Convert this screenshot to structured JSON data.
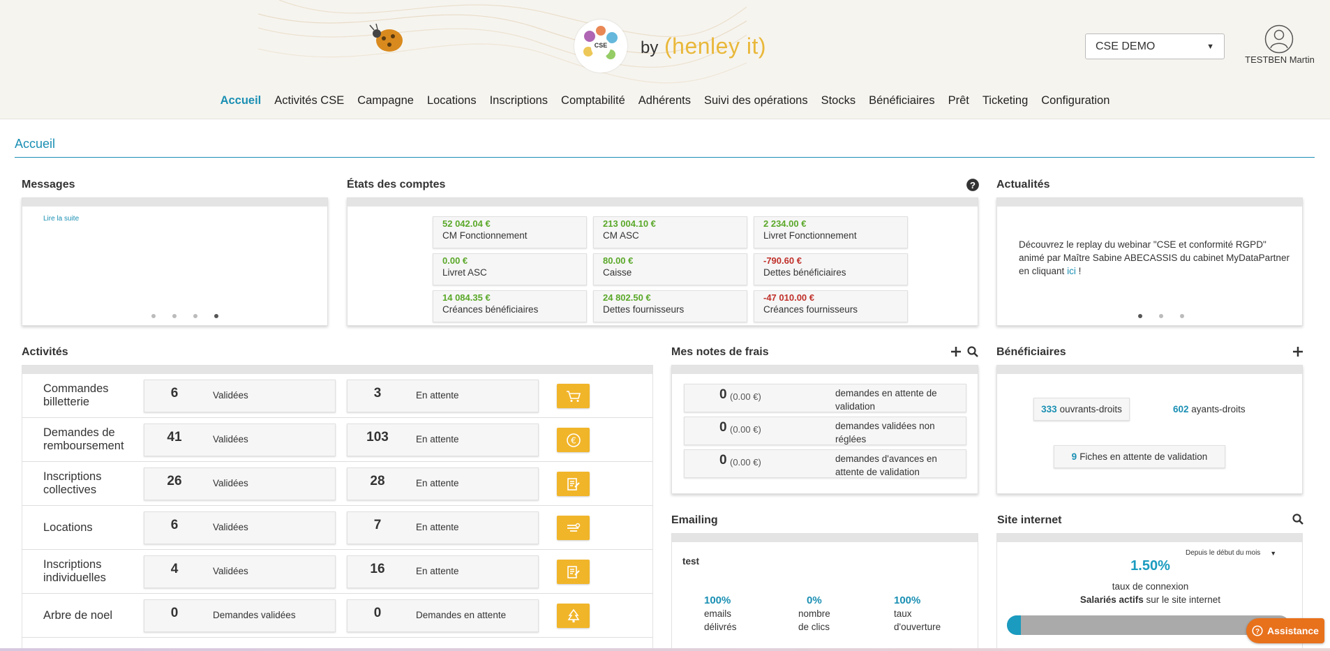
{
  "header": {
    "logo_text": "CSE",
    "by": "by",
    "brand": "(henley it)",
    "company_select": "CSE DEMO",
    "user_name": "TESTBEN Martin"
  },
  "nav": [
    "Accueil",
    "Activités CSE",
    "Campagne",
    "Locations",
    "Inscriptions",
    "Comptabilité",
    "Adhérents",
    "Suivi des opérations",
    "Stocks",
    "Bénéficiaires",
    "Prêt",
    "Ticketing",
    "Configuration"
  ],
  "page_title": "Accueil",
  "messages": {
    "title": "Messages",
    "read_more": "Lire la suite"
  },
  "accounts": {
    "title": "États des comptes",
    "items": [
      {
        "amount": "52 042.04 €",
        "label": "CM Fonctionnement",
        "tone": "pos"
      },
      {
        "amount": "213 004.10 €",
        "label": "CM ASC",
        "tone": "pos"
      },
      {
        "amount": "2 234.00 €",
        "label": "Livret Fonctionnement",
        "tone": "pos"
      },
      {
        "amount": "0.00 €",
        "label": "Livret ASC",
        "tone": "pos"
      },
      {
        "amount": "80.00 €",
        "label": "Caisse",
        "tone": "pos"
      },
      {
        "amount": "-790.60 €",
        "label": "Dettes bénéficiaires",
        "tone": "neg"
      },
      {
        "amount": "14 084.35 €",
        "label": "Créances bénéficiaires",
        "tone": "pos"
      },
      {
        "amount": "24 802.50 €",
        "label": "Dettes fournisseurs",
        "tone": "pos"
      },
      {
        "amount": "-47 010.00 €",
        "label": "Créances fournisseurs",
        "tone": "neg"
      }
    ]
  },
  "news": {
    "title": "Actualités",
    "text_1": "Découvrez le replay du webinar \"CSE et conformité RGPD\"",
    "text_2": "animé par Maître Sabine ABECASSIS du cabinet MyDataPartner",
    "text_3": "en cliquant",
    "link": "ici",
    "text_4": " !"
  },
  "activities": {
    "title": "Activités",
    "rows": [
      {
        "label_1": "Commandes",
        "label_2": "billetterie",
        "validated": "6",
        "validated_label": "Validées",
        "pending": "3",
        "pending_label": "En attente",
        "icon": "cart-icon"
      },
      {
        "label_1": "Demandes de",
        "label_2": "remboursement",
        "validated": "41",
        "validated_label": "Validées",
        "pending": "103",
        "pending_label": "En attente",
        "icon": "euro-icon"
      },
      {
        "label_1": "Inscriptions",
        "label_2": "collectives",
        "validated": "26",
        "validated_label": "Validées",
        "pending": "28",
        "pending_label": "En attente",
        "icon": "form-icon"
      },
      {
        "label_1": "Locations",
        "label_2": "",
        "validated": "6",
        "validated_label": "Validées",
        "pending": "7",
        "pending_label": "En attente",
        "icon": "key-icon"
      },
      {
        "label_1": "Inscriptions",
        "label_2": "individuelles",
        "validated": "4",
        "validated_label": "Validées",
        "pending": "16",
        "pending_label": "En attente",
        "icon": "form-icon"
      },
      {
        "label_1": "Arbre de noel",
        "label_2": "",
        "validated": "0",
        "validated_label": "Demandes validées",
        "pending": "0",
        "pending_label": "Demandes en attente",
        "icon": "tree-icon"
      }
    ]
  },
  "expenses": {
    "title": "Mes notes de frais",
    "rows": [
      {
        "count": "0",
        "amount": "(0.00 €)",
        "desc": "demandes en attente de validation"
      },
      {
        "count": "0",
        "amount": "(0.00 €)",
        "desc": "demandes validées non réglées"
      },
      {
        "count": "0",
        "amount": "(0.00 €)",
        "desc": "demandes d'avances en attente de validation"
      }
    ]
  },
  "beneficiaries": {
    "title": "Bénéficiaires",
    "openers_count": "333",
    "openers_label": "ouvrants-droits",
    "holders_count": "602",
    "holders_label": "ayants-droits",
    "pending_count": "9",
    "pending_label": "Fiches en attente de validation"
  },
  "emailing": {
    "title": "Emailing",
    "campaign": "test",
    "stats": [
      {
        "pct": "100%",
        "line1": "emails",
        "line2": "délivrés"
      },
      {
        "pct": "0%",
        "line1": "nombre",
        "line2": "de clics"
      },
      {
        "pct": "100%",
        "line1": "taux",
        "line2": "d'ouverture"
      }
    ]
  },
  "website": {
    "title": "Site internet",
    "period": "Depuis le début du mois",
    "rate": "1.50%",
    "rate_fraction": 0.015,
    "rate_label": "taux de connexion",
    "employees_bold": "Salariés actifs",
    "employees_rest": "sur le site internet"
  },
  "assistance": "Assistance"
}
